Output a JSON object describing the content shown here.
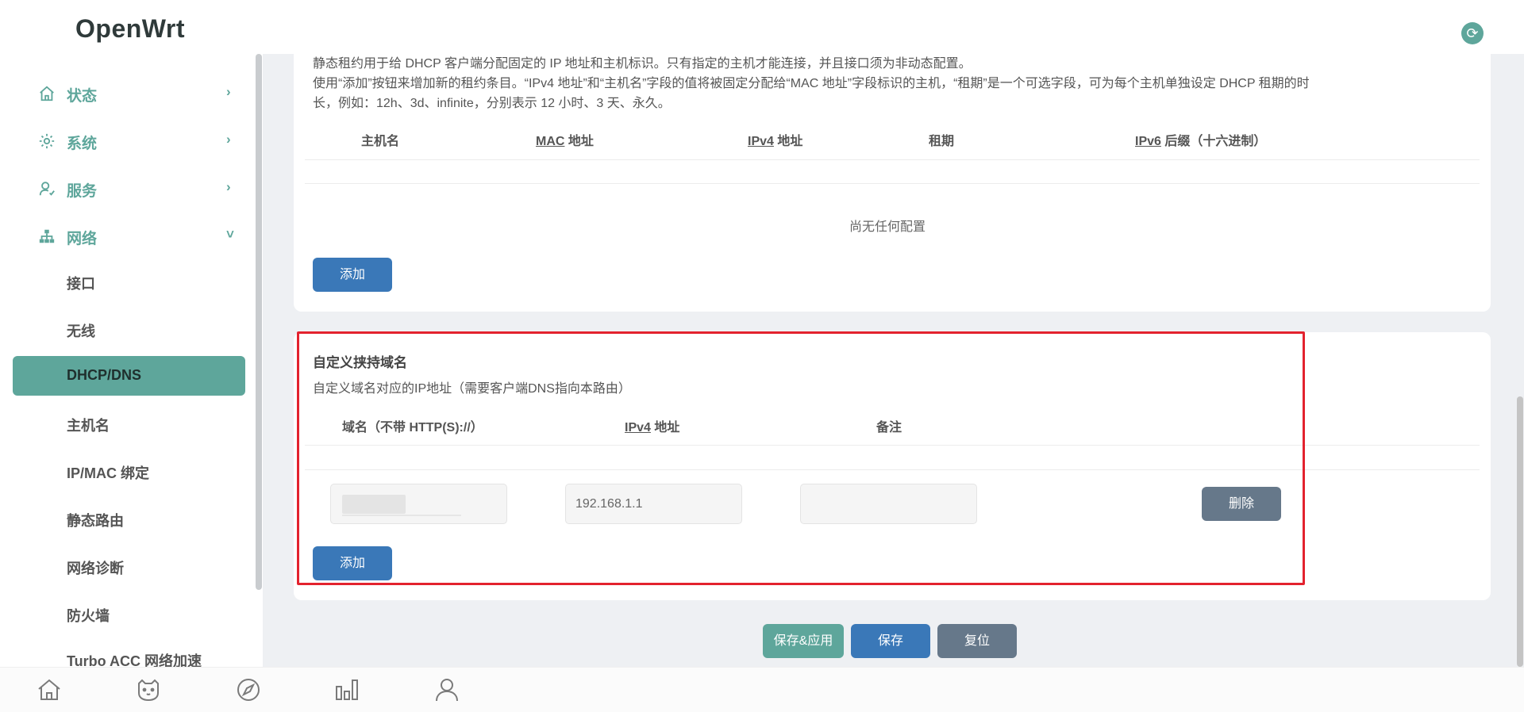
{
  "header": {
    "brand": "OpenWrt",
    "refresh_icon": "refresh-icon"
  },
  "sidebar": {
    "menus": [
      {
        "label": "状态",
        "icon": "home-icon",
        "arrow": "›"
      },
      {
        "label": "系统",
        "icon": "gear-icon",
        "arrow": "›"
      },
      {
        "label": "服务",
        "icon": "user-service-icon",
        "arrow": "›"
      },
      {
        "label": "网络",
        "icon": "network-tree-icon",
        "arrow": "˅"
      }
    ],
    "sub_items": [
      "接口",
      "无线",
      "DHCP/DNS",
      "主机名",
      "IP/MAC 绑定",
      "静态路由",
      "网络诊断",
      "防火墙",
      "Turbo ACC 网络加速"
    ],
    "active_sub": "DHCP/DNS"
  },
  "static_leases": {
    "desc_line1": "静态租约用于给 DHCP 客户端分配固定的 IP 地址和主机标识。只有指定的主机才能连接，并且接口须为非动态配置。",
    "desc_line2": "使用“添加”按钮来增加新的租约条目。“IPv4 地址”和“主机名”字段的值将被固定分配给“MAC 地址”字段标识的主机，“租期”是一个可选字段，可为每个主机单独设定 DHCP 租期的时",
    "desc_line3": "长，例如：12h、3d、infinite，分别表示 12 小时、3 天、永久。",
    "columns": {
      "hostname": "主机名",
      "mac_abbr": "MAC",
      "mac_rest": " 地址",
      "ipv4_abbr": "IPv4",
      "ipv4_rest": " 地址",
      "lease": "租期",
      "ipv6_abbr": "IPv6",
      "ipv6_rest": " 后缀（十六进制）"
    },
    "empty_text": "尚无任何配置",
    "add_label": "添加"
  },
  "hijack": {
    "title": "自定义挟持域名",
    "desc": "自定义域名对应的IP地址（需要客户端DNS指向本路由）",
    "columns": {
      "domain": "域名（不带 HTTP(S)://）",
      "ipv4_abbr": "IPv4",
      "ipv4_rest": " 地址",
      "note": "备注"
    },
    "row": {
      "domain_value": "",
      "ipv4_value": "192.168.1.1",
      "note_value": ""
    },
    "delete_label": "删除",
    "add_label": "添加"
  },
  "actions": {
    "save_apply": "保存&应用",
    "save": "保存",
    "reset": "复位"
  },
  "bottom_nav": [
    "home-icon",
    "cat-icon",
    "compass-icon",
    "bar-chart-icon",
    "user-icon"
  ],
  "colors": {
    "accent": "#5ea69b",
    "primary": "#3a78b8",
    "danger_outline": "#e3222e",
    "neutral_button": "#66788a"
  }
}
